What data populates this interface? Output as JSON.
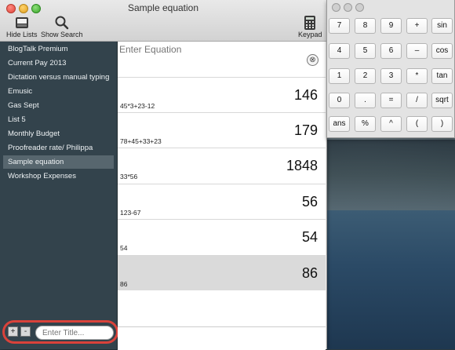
{
  "window": {
    "title": "Sample equation"
  },
  "toolbar": {
    "hide_lists_label": "Hide Lists",
    "show_search_label": "Show Search",
    "keypad_label": "Keypad"
  },
  "sidebar": {
    "items": [
      {
        "label": "BlogTalk Premium"
      },
      {
        "label": "Current Pay 2013"
      },
      {
        "label": "Dictation versus manual typing"
      },
      {
        "label": "Emusic"
      },
      {
        "label": "Gas Sept"
      },
      {
        "label": "List 5"
      },
      {
        "label": "Monthly Budget"
      },
      {
        "label": "Proofreader rate/ Philippa"
      },
      {
        "label": "Sample equation",
        "selected": true
      },
      {
        "label": "Workshop Expenses"
      }
    ],
    "add_label": "+",
    "remove_label": "-",
    "title_placeholder": "Enter Title..."
  },
  "equation": {
    "placeholder": "Enter Equation",
    "clear_symbol": "⊗"
  },
  "rows": [
    {
      "expr": "45*3+23-12",
      "result": "146"
    },
    {
      "expr": "78+45+33+23",
      "result": "179"
    },
    {
      "expr": "33*56",
      "result": "1848"
    },
    {
      "expr": "123-67",
      "result": "56"
    },
    {
      "expr": "54",
      "result": "54"
    },
    {
      "expr": "86",
      "result": "86"
    }
  ],
  "keypad": {
    "keys": [
      [
        "7",
        "8",
        "9",
        "+",
        "sin"
      ],
      [
        "4",
        "5",
        "6",
        "–",
        "cos"
      ],
      [
        "1",
        "2",
        "3",
        "*",
        "tan"
      ],
      [
        "0",
        ".",
        "=",
        "/",
        "sqrt"
      ],
      [
        "ans",
        "%",
        "^",
        "(",
        ")"
      ]
    ]
  },
  "colors": {
    "sidebar_bg": "#33434c",
    "sidebar_selected": "#57666e",
    "highlight_ring": "#d9423a"
  }
}
